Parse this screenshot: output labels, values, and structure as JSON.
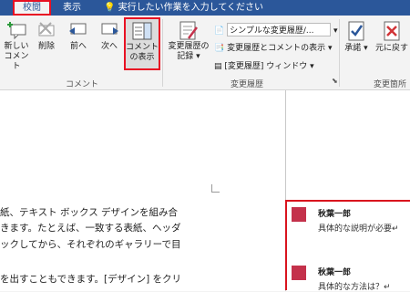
{
  "tabs": [
    {
      "label": "校閲",
      "active": true
    },
    {
      "label": "表示",
      "active": false
    }
  ],
  "tell_me": "実行したい作業を入力してください",
  "ribbon": {
    "comment_group": {
      "label": "コメント",
      "new_comment": "新しい\nコメント",
      "new_comment_l1": "新しい",
      "new_comment_l2": "コメント",
      "delete": "削除",
      "previous": "前へ",
      "next": "次へ",
      "show_comments_l1": "コメント",
      "show_comments_l2": "の表示"
    },
    "tracking_group": {
      "label": "変更履歴",
      "track_changes_l1": "変更履歴の",
      "track_changes_l2": "記録",
      "display_for_review": "シンプルな変更履歴/...",
      "show_markup": "変更履歴とコメントの表示",
      "reviewing_pane": "[変更履歴] ウィンドウ"
    },
    "changes_group": {
      "label": "変更箇所",
      "accept": "承諾",
      "reject": "元に戻す"
    }
  },
  "document": {
    "lines": [
      "紙、テキスト ボックス デザインを組み合",
      "きます。たとえば、一致する表紙、ヘッダ",
      "ックしてから、それぞれのギャラリーで目",
      "を出すこともできます。[デザイン] をクリ"
    ]
  },
  "comments": [
    {
      "author": "秋葉一郎",
      "text": "具体的な説明が必要↵"
    },
    {
      "author": "秋葉一郎",
      "text": "具体的な方法は？↵"
    }
  ],
  "colors": {
    "title_bar": "#2b579a",
    "highlight": "#e81123",
    "avatar": "#c4314b"
  }
}
